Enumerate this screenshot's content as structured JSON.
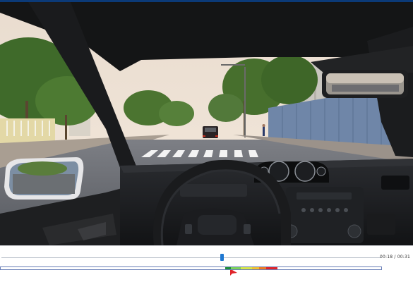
{
  "player": {
    "time_readout": "00:18 / 00:31",
    "playhead_fraction": 0.58
  },
  "timeline": {
    "segments": [
      {
        "color": "#1e8f3a"
      },
      {
        "color": "#7dd35a"
      },
      {
        "color": "#d7e64a"
      },
      {
        "color": "#f2c230"
      },
      {
        "color": "#ef7b22"
      },
      {
        "color": "#e0242a"
      }
    ],
    "marker_icon": "flag-icon",
    "marker_color": "#e0242a"
  },
  "scene": {
    "description_icon": "driving-simulator-view"
  }
}
